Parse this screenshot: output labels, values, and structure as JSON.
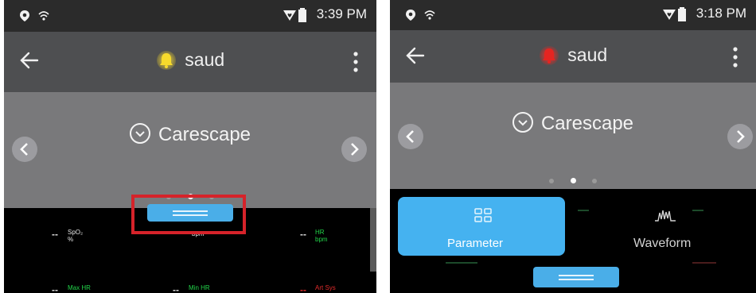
{
  "left": {
    "status_time": "3:39 PM",
    "title": "saud",
    "bell_color": "#f4d628",
    "device_name": "Carescape",
    "params": [
      {
        "label": "SpO₂",
        "unit": "%",
        "value": "--",
        "color": "#e6e6e6"
      },
      {
        "label": "",
        "unit": "bpm",
        "value": "",
        "color": "#e6e6e6"
      },
      {
        "label": "HR",
        "unit": "bpm",
        "value": "--",
        "color": "#22d64a"
      },
      {
        "label": "Max HR",
        "unit": "",
        "value": "--",
        "color": "#22d64a"
      },
      {
        "label": "Min HR",
        "unit": "",
        "value": "--",
        "color": "#22d64a"
      },
      {
        "label": "Art Sys",
        "unit": "",
        "value": "--",
        "color": "#e22b2b"
      }
    ]
  },
  "right": {
    "status_time": "3:18 PM",
    "title": "saud",
    "bell_color": "#e52521",
    "device_name": "Carescape",
    "tabs": [
      {
        "label": "Parameter",
        "active": true
      },
      {
        "label": "Waveform",
        "active": false
      }
    ]
  },
  "colors": {
    "accent": "#45b2f0",
    "highlight": "#d6232a"
  }
}
